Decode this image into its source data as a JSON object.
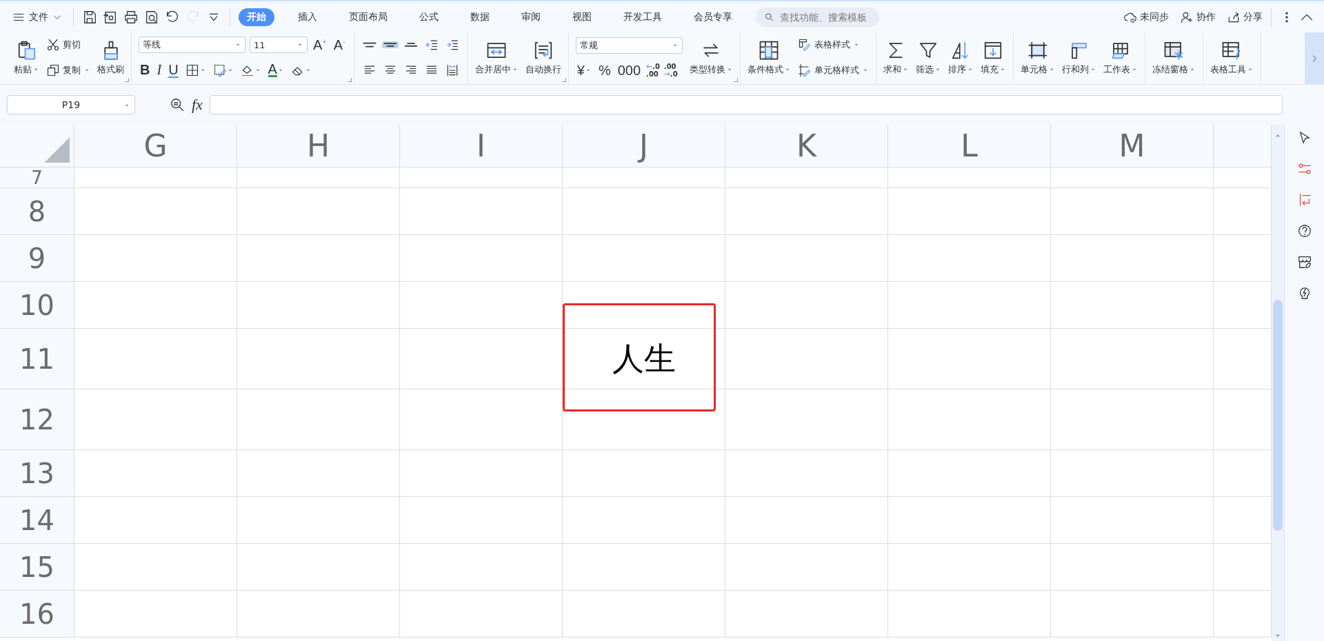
{
  "menu": {
    "label": "文件"
  },
  "quick_access": [
    {
      "disabled": false
    },
    {
      "disabled": false
    },
    {
      "disabled": false
    },
    {
      "disabled": false
    },
    {
      "disabled": false
    },
    {
      "disabled": true
    },
    {
      "disabled": false
    }
  ],
  "tabs": [
    {
      "label": "开始",
      "selected": true
    },
    {
      "label": "插入",
      "selected": false
    },
    {
      "label": "页面布局",
      "selected": false
    },
    {
      "label": "公式",
      "selected": false
    },
    {
      "label": "数据",
      "selected": false
    },
    {
      "label": "审阅",
      "selected": false
    },
    {
      "label": "视图",
      "selected": false
    },
    {
      "label": "开发工具",
      "selected": false
    },
    {
      "label": "会员专享",
      "selected": false
    }
  ],
  "search": {
    "placeholder": "查找功能、搜索模板"
  },
  "top_actions": [
    {
      "label": "未同步"
    },
    {
      "label": "协作"
    },
    {
      "label": "分享"
    }
  ],
  "ribbon": [
    {
      "launcher": true,
      "columns": [
        [
          [
            {
              "kind": "large",
              "label": "粘贴",
              "dropdown": true
            }
          ]
        ],
        [
          [
            {
              "kind": "small",
              "label": "剪切",
              "dropdown": false
            }
          ],
          [
            {
              "kind": "small",
              "label": "复制",
              "dropdown": true
            }
          ]
        ],
        [
          [
            {
              "kind": "large",
              "label": "格式刷",
              "dropdown": false
            }
          ]
        ]
      ]
    },
    {
      "launcher": true,
      "columns": [
        [
          [
            {
              "kind": "select",
              "value": "等线"
            },
            {
              "kind": "select",
              "value": "11"
            },
            {
              "kind": "glyph",
              "label": "A$^{+}$"
            },
            {
              "kind": "glyph",
              "label": "A$^{-}$"
            }
          ],
          [
            {
              "kind": "bold",
              "label": "B"
            },
            {
              "kind": "italic",
              "label": "I"
            },
            {
              "kind": "underline",
              "label": "U"
            },
            {
              "kind": "icon",
              "dropdown": true
            },
            {
              "kind": "icon",
              "dropdown": true
            },
            {
              "kind": "icon",
              "dropdown": true
            },
            {
              "kind": "fontcolor",
              "label": "A",
              "dropdown": true
            },
            {
              "kind": "icon",
              "dropdown": true
            }
          ]
        ]
      ]
    },
    {
      "launcher": false,
      "columns": [
        [
          [
            {
              "kind": "icon",
              "selected": false
            },
            {
              "kind": "icon",
              "selected": true
            },
            {
              "kind": "icon",
              "selected": false
            },
            {
              "kind": "icon",
              "selected": false
            },
            {
              "kind": "icon",
              "selected": false
            }
          ],
          [
            {
              "kind": "icon",
              "selected": false
            },
            {
              "kind": "icon",
              "selected": false
            },
            {
              "kind": "icon",
              "selected": false
            },
            {
              "kind": "icon",
              "selected": false
            },
            {
              "kind": "icon",
              "selected": false
            }
          ]
        ]
      ]
    },
    {
      "launcher": true,
      "columns": [
        [
          [
            {
              "kind": "large",
              "label": "合并居中",
              "dropdown": true
            }
          ]
        ],
        [
          [
            {
              "kind": "large",
              "label": "自动换行",
              "dropdown": false
            }
          ]
        ]
      ]
    },
    {
      "launcher": true,
      "columns": [
        [
          [
            {
              "kind": "select",
              "value": "常规"
            }
          ],
          [
            {
              "kind": "glyph",
              "label": "¥",
              "dropdown": true
            },
            {
              "kind": "glyph",
              "label": "%"
            },
            {
              "kind": "glyph",
              "label": "000"
            },
            {
              "kind": "decimal",
              "lines": [
                ".0",
                ".00"
              ]
            },
            {
              "kind": "decimal",
              "lines": [
                ".00",
                ".0"
              ]
            }
          ]
        ],
        [
          [
            {
              "kind": "large",
              "label": "类型转换",
              "dropdown": true
            }
          ]
        ]
      ]
    },
    {
      "launcher": false,
      "columns": [
        [
          [
            {
              "kind": "large",
              "label": "条件格式",
              "dropdown": true
            }
          ]
        ],
        [
          [
            {
              "kind": "small",
              "label": "表格样式",
              "dropdown": true
            }
          ],
          [
            {
              "kind": "small",
              "label": "单元格样式",
              "dropdown": true
            }
          ]
        ]
      ]
    },
    {
      "launcher": false,
      "columns": [
        [
          [
            {
              "kind": "large",
              "label": "求和",
              "dropdown": true
            }
          ]
        ],
        [
          [
            {
              "kind": "large",
              "label": "筛选",
              "dropdown": true
            }
          ]
        ],
        [
          [
            {
              "kind": "large",
              "label": "排序",
              "dropdown": true
            }
          ]
        ],
        [
          [
            {
              "kind": "large",
              "label": "填充",
              "dropdown": true
            }
          ]
        ]
      ]
    },
    {
      "launcher": false,
      "columns": [
        [
          [
            {
              "kind": "large",
              "label": "单元格",
              "dropdown": true
            }
          ]
        ],
        [
          [
            {
              "kind": "large",
              "label": "行和列",
              "dropdown": true
            }
          ]
        ],
        [
          [
            {
              "kind": "large",
              "label": "工作表",
              "dropdown": true
            }
          ]
        ]
      ]
    },
    {
      "launcher": false,
      "columns": [
        [
          [
            {
              "kind": "large",
              "label": "冻结窗格",
              "dropdown": true
            }
          ]
        ]
      ]
    },
    {
      "launcher": false,
      "columns": [
        [
          [
            {
              "kind": "large",
              "label": "表格工具",
              "dropdown": true
            }
          ]
        ]
      ]
    }
  ],
  "name_box": {
    "value": "P19"
  },
  "formula_bar": {
    "label": "fx"
  },
  "sheet": {
    "columns": [
      "G",
      "H",
      "I",
      "J",
      "K",
      "L",
      "M"
    ],
    "rows": [
      {
        "header": "7"
      },
      {
        "header": "8"
      },
      {
        "header": "9"
      },
      {
        "header": "10"
      },
      {
        "header": "11",
        "cells": {
          "J": {
            "text": "人生",
            "annotated": true
          }
        }
      },
      {
        "header": "12"
      },
      {
        "header": "13"
      },
      {
        "header": "14"
      },
      {
        "header": "15"
      },
      {
        "header": "16"
      }
    ]
  }
}
